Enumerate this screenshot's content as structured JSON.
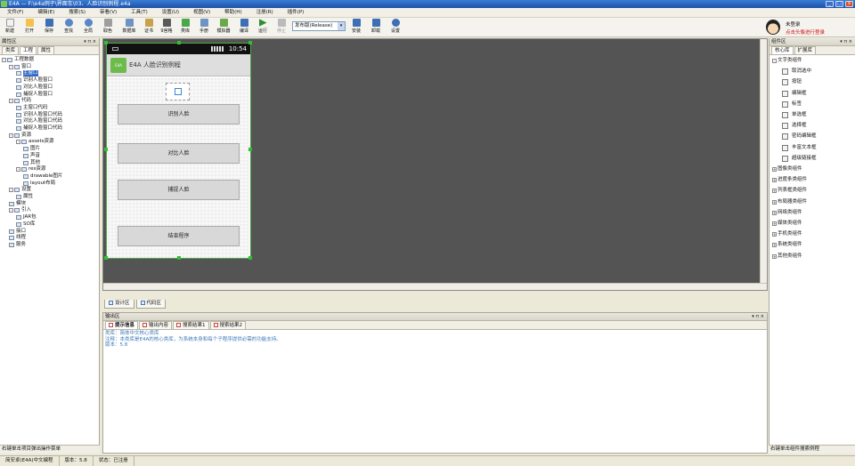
{
  "window": {
    "title": "E4A — F:\\e4a例子\\界面车\\03、人脸识别例程.e4a"
  },
  "menu": [
    "文件(F)",
    "编辑(E)",
    "搜索(S)",
    "审看(V)",
    "工具(T)",
    "设置(U)",
    "视图(V)",
    "帮助(H)",
    "注册(R)",
    "插件(P)"
  ],
  "toolbar": {
    "buttons": [
      {
        "label": "新建",
        "icon": "new-file-icon",
        "color": "#f2f2f2"
      },
      {
        "label": "打开",
        "icon": "open-folder-icon",
        "color": "#f4c04e"
      },
      {
        "label": "保存",
        "icon": "save-icon",
        "color": "#3c6fb6"
      },
      {
        "label": "查找",
        "icon": "find-icon",
        "color": "#5a86c8"
      },
      {
        "label": "全局",
        "icon": "global-find-icon",
        "color": "#5a86c8"
      },
      {
        "label": "取色",
        "icon": "color-picker-icon",
        "color": "#9e9e9e"
      },
      {
        "label": "数据库",
        "icon": "database-icon",
        "color": "#6e93c4"
      },
      {
        "label": "证书",
        "icon": "certificate-icon",
        "color": "#c8a24a"
      },
      {
        "label": "9宫格",
        "icon": "grid9-icon",
        "color": "#5a5a5a"
      },
      {
        "label": "类库",
        "icon": "class-library-icon",
        "color": "#4aa84a"
      },
      {
        "label": "手册",
        "icon": "manual-icon",
        "color": "#6e93c4"
      },
      {
        "label": "模拟器",
        "icon": "emulator-icon",
        "color": "#6aa84a"
      },
      {
        "label": "编译",
        "icon": "compile-icon",
        "color": "#3c6fb6"
      },
      {
        "label": "运行",
        "icon": "run-icon",
        "color": "#2f8f2f"
      },
      {
        "label": "停止",
        "icon": "stop-icon",
        "color": "#bbbbbb",
        "disabled": true
      },
      {
        "label": "安装",
        "icon": "install-icon",
        "color": "#3c6fb6"
      },
      {
        "label": "卸载",
        "icon": "uninstall-icon",
        "color": "#3c6fb6"
      },
      {
        "label": "设置",
        "icon": "settings-icon",
        "color": "#3c6fb6"
      }
    ],
    "build_mode": "发布版(Release)"
  },
  "user": {
    "status": "未登录",
    "login_hint": "点击头像进行登录"
  },
  "left_panel": {
    "title": "属性区",
    "tabs": [
      "类库",
      "工程",
      "属性"
    ],
    "tree": [
      {
        "label": "工程数据",
        "level": 0,
        "pm": "-"
      },
      {
        "label": "窗口",
        "level": 1,
        "pm": "-"
      },
      {
        "label": "主窗口",
        "level": 2,
        "selected": true
      },
      {
        "label": "识别人脸窗口",
        "level": 2
      },
      {
        "label": "对比人脸窗口",
        "level": 2
      },
      {
        "label": "捕捉人脸窗口",
        "level": 2
      },
      {
        "label": "代码",
        "level": 1,
        "pm": "-"
      },
      {
        "label": "主窗口代码",
        "level": 2
      },
      {
        "label": "识别人脸窗口代码",
        "level": 2
      },
      {
        "label": "对比人脸窗口代码",
        "level": 2
      },
      {
        "label": "捕捉人脸窗口代码",
        "level": 2
      },
      {
        "label": "资源",
        "level": 1,
        "pm": "-"
      },
      {
        "label": "assets资源",
        "level": 2,
        "pm": "-"
      },
      {
        "label": "图片",
        "level": 3
      },
      {
        "label": "声音",
        "level": 3
      },
      {
        "label": "其他",
        "level": 3
      },
      {
        "label": "res资源",
        "level": 2,
        "pm": "-"
      },
      {
        "label": "drawable图片",
        "level": 3
      },
      {
        "label": "layout布局",
        "level": 3
      },
      {
        "label": "设置",
        "level": 1,
        "pm": "-"
      },
      {
        "label": "属性",
        "level": 2
      },
      {
        "label": "模块",
        "level": 1
      },
      {
        "label": "引入",
        "level": 1,
        "pm": "-"
      },
      {
        "label": "JAR包",
        "level": 2
      },
      {
        "label": "SO库",
        "level": 2
      },
      {
        "label": "接口",
        "level": 1
      },
      {
        "label": "线程",
        "level": 1
      },
      {
        "label": "服务",
        "level": 1
      }
    ],
    "status": "右键单击项目弹出操作菜单"
  },
  "phone": {
    "time": "10:54",
    "app_title": "E4A 人脸识别例程",
    "logo_text": "E4A",
    "buttons": [
      "识别人脸",
      "对比人脸",
      "捕捉人脸",
      "结束程序"
    ]
  },
  "design_tabs": [
    "设计区",
    "代码区"
  ],
  "output": {
    "title": "输出区",
    "tabs": [
      "提示信息",
      "输出内容",
      "搜索结果1",
      "搜索结果2"
    ],
    "lines": [
      "类库：简体中文核心类库",
      "注释：本类库是E4A的核心类库，为系统本身和每个子程序提供必需的功能支持。",
      "版本：5.8"
    ]
  },
  "right_panel": {
    "title": "组件区",
    "tabs": [
      "核心库",
      "扩展库"
    ],
    "group_open": "文字类组件",
    "items": [
      "取消选中",
      "按钮",
      "编辑框",
      "标签",
      "单选框",
      "选择框",
      "密码编辑框",
      "丰富文本框",
      "超级链接框"
    ],
    "groups": [
      "图像类组件",
      "进度条类组件",
      "列表框类组件",
      "布局器类组件",
      "网络类组件",
      "媒体类组件",
      "手机类组件",
      "系统类组件",
      "其他类组件"
    ],
    "status": "右键单击组件搜索例程"
  },
  "statusbar": {
    "items": [
      "简安卓(E4A)中文编程",
      "版本：5.8",
      "状态：已注册"
    ]
  }
}
